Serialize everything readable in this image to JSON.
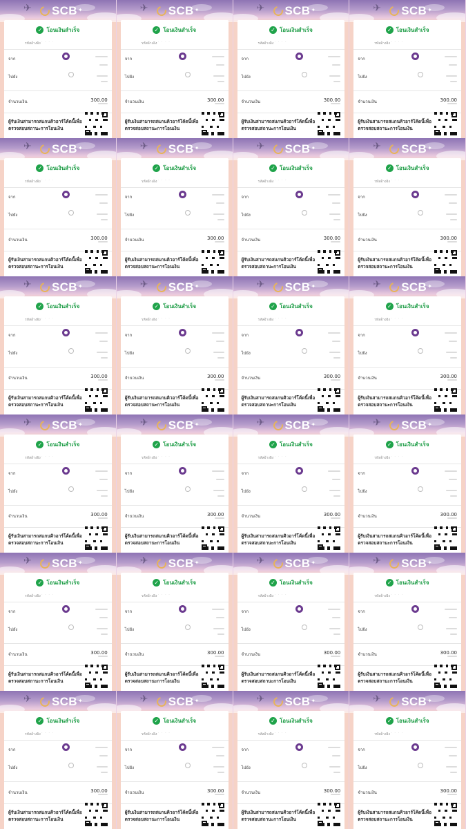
{
  "bank": {
    "name": "SCB",
    "sparkle": "✦"
  },
  "slip": {
    "status": "โอนเงินสำเร็จ",
    "ref_label": "รหัสอ้างอิง",
    "from_label": "จาก",
    "to_label": "ไปยัง",
    "amount_label": "จำนวนเงิน",
    "amount": "300.00",
    "verify_line1": "ผู้รับเงินสามารถสแกนคิวอาร์โค้ดนี้เพื่อ",
    "verify_line2": "ตรวจสอบสถานะการโอนเงิน"
  },
  "colors": {
    "success": "#1fa34a",
    "brand_purple": "#6b3a8f",
    "banner_top": "#8e74b4",
    "background": "#f6d3c7"
  },
  "icons": {
    "status": "check-circle-icon",
    "bird": "bird-icon",
    "logo": "scb-logo-icon",
    "qr": "qr-code-icon"
  },
  "grid": {
    "columns": 4,
    "rows": 6
  }
}
